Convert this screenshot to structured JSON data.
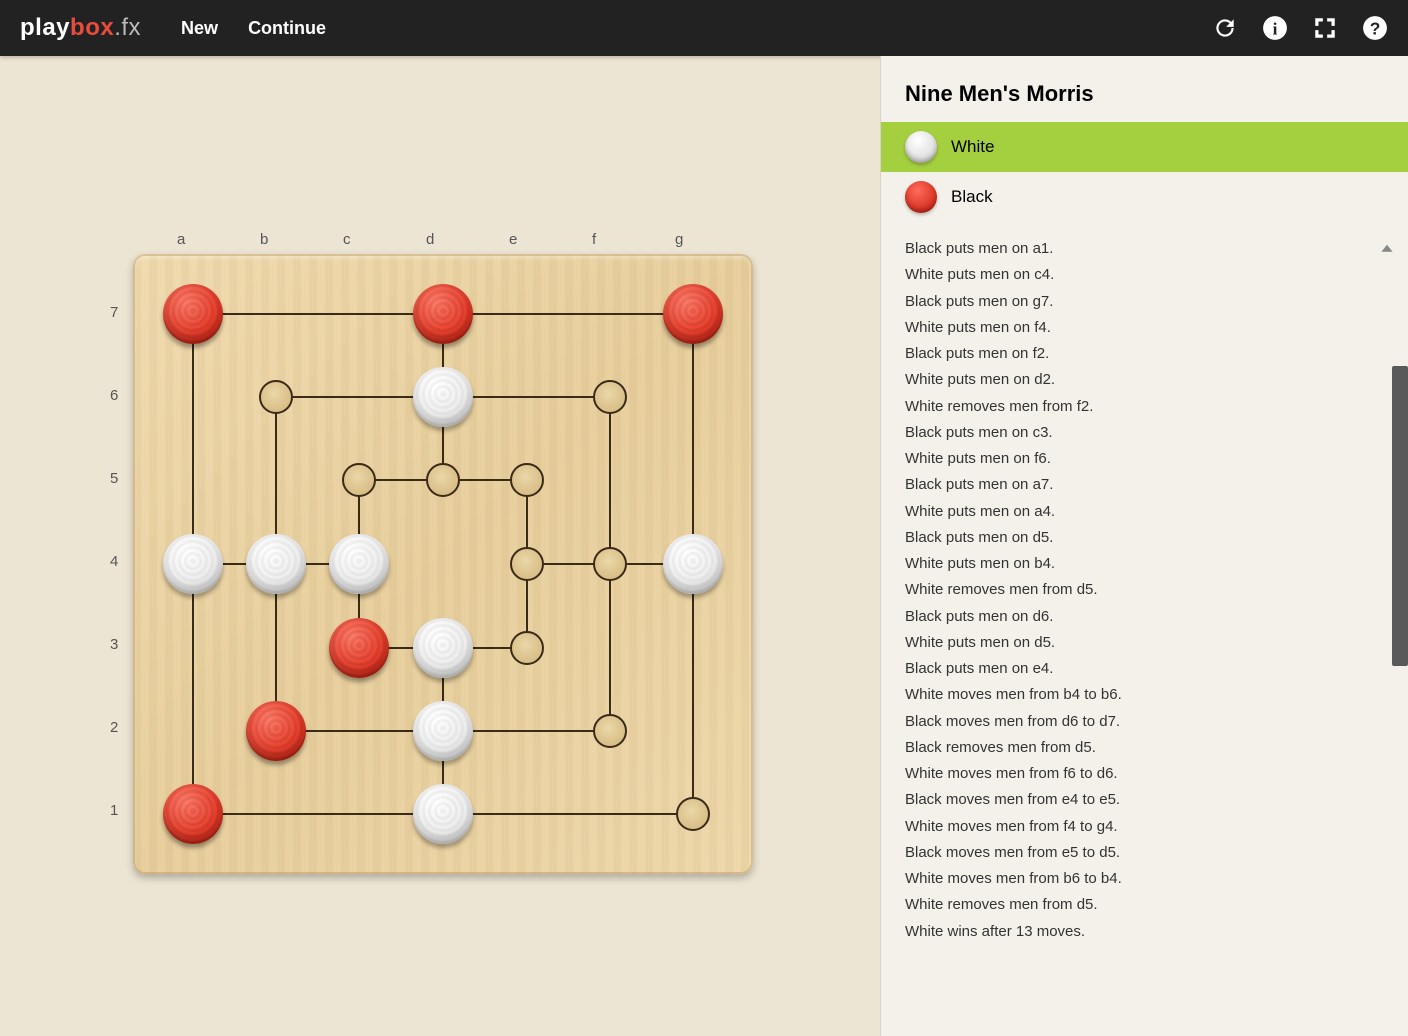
{
  "header": {
    "logo": {
      "play": "play",
      "box": "box",
      "fx": ".fx"
    },
    "nav": {
      "new": "New",
      "continue": "Continue"
    }
  },
  "side": {
    "title": "Nine Men's Morris",
    "players": [
      {
        "name": "White",
        "color": "white",
        "active": true
      },
      {
        "name": "Black",
        "color": "black",
        "active": false
      }
    ],
    "history": [
      "Black puts men on a1.",
      "White puts men on c4.",
      "Black puts men on g7.",
      "White puts men on f4.",
      "Black puts men on f2.",
      "White puts men on d2.",
      "White removes men from f2.",
      "Black puts men on c3.",
      "White puts men on f6.",
      "Black puts men on a7.",
      "White puts men on a4.",
      "Black puts men on d5.",
      "White puts men on b4.",
      "White removes men from d5.",
      "Black puts men on d6.",
      "White puts men on d5.",
      "Black puts men on e4.",
      "White moves men from b4 to b6.",
      "Black moves men from d6 to d7.",
      "Black removes men from d5.",
      "White moves men from f6 to d6.",
      "Black moves men from e4 to e5.",
      "White moves men from f4 to g4.",
      "Black moves men from e5 to d5.",
      "White moves men from b6 to b4.",
      "White removes men from d5.",
      "White wins after 13 moves."
    ]
  },
  "board": {
    "cols": [
      "a",
      "b",
      "c",
      "d",
      "e",
      "f",
      "g"
    ],
    "rows": [
      "7",
      "6",
      "5",
      "4",
      "3",
      "2",
      "1"
    ],
    "points": [
      "a7",
      "d7",
      "g7",
      "b6",
      "d6",
      "f6",
      "c5",
      "d5",
      "e5",
      "a4",
      "b4",
      "c4",
      "e4",
      "f4",
      "g4",
      "c3",
      "d3",
      "e3",
      "b2",
      "d2",
      "f2",
      "a1",
      "d1",
      "g1"
    ],
    "pieces": {
      "a7": "r",
      "d7": "r",
      "g7": "r",
      "d6": "w",
      "a4": "w",
      "b4": "w",
      "c4": "w",
      "g4": "w",
      "c3": "r",
      "d3": "w",
      "b2": "r",
      "d2": "w",
      "a1": "r",
      "d1": "w"
    }
  }
}
